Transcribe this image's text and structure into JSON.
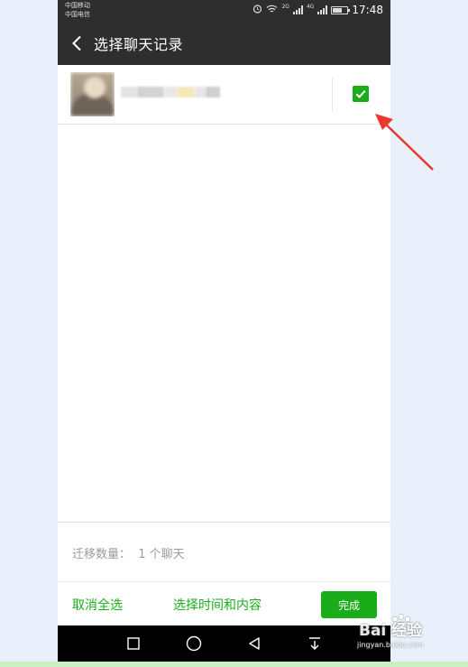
{
  "status_bar": {
    "carrier_1": "中国移动",
    "carrier_2": "中国电信",
    "net_1": "2G",
    "net_2": "4G",
    "time": "17:48",
    "icons": [
      "alarm-icon",
      "wifi-icon",
      "signal-icon",
      "signal-icon",
      "battery-icon"
    ]
  },
  "header": {
    "back_icon": "back-arrow-icon",
    "title": "选择聊天记录"
  },
  "chat_list": {
    "items": [
      {
        "avatar": "avatar-image",
        "selected": true
      }
    ]
  },
  "summary": {
    "label": "迁移数量：  1 个聊天"
  },
  "bottom_bar": {
    "deselect_all": "取消全选",
    "select_time_content": "选择时间和内容",
    "done": "完成"
  },
  "nav_bar": {
    "icons": [
      "square-icon",
      "circle-icon",
      "triangle-back-icon",
      "notification-down-icon"
    ]
  },
  "watermark": {
    "brand": "Bai 经验",
    "url": "jingyan.baidu.com"
  },
  "colors": {
    "accent": "#1aad19",
    "header_bg": "#2e2e2e",
    "annotation": "#e8392f",
    "page_bg": "#eaf0fb"
  }
}
